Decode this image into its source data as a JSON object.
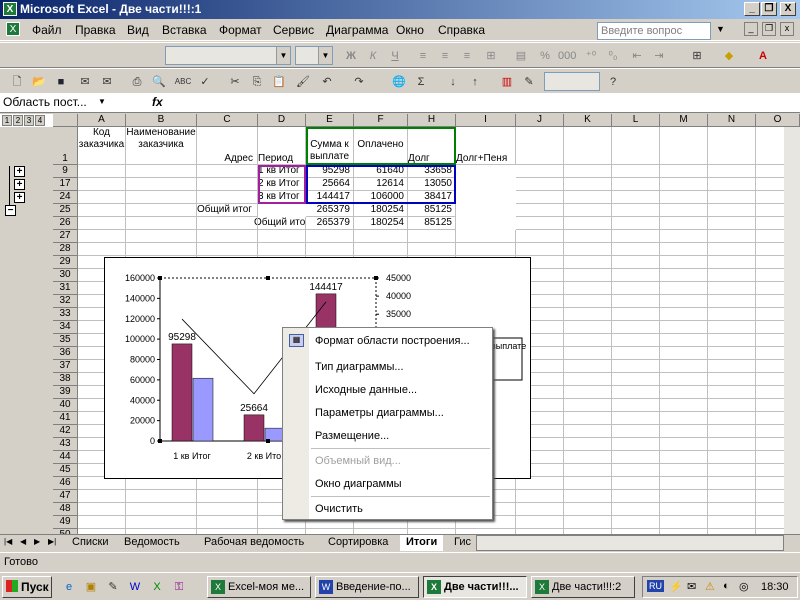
{
  "window": {
    "title": "Microsoft Excel - Две части!!!:1",
    "minimize": "_",
    "restore": "❐",
    "close": "X"
  },
  "menu": {
    "items": [
      "Файл",
      "Правка",
      "Вид",
      "Вставка",
      "Формат",
      "Сервис",
      "Диаграмма",
      "Окно",
      "Справка"
    ],
    "help_placeholder": "Введите вопрос"
  },
  "toolbar": {
    "zoom": ""
  },
  "formula": {
    "name_box": "Область пост...",
    "fx": "fx",
    "value": ""
  },
  "outline": {
    "levels": [
      "1",
      "2",
      "3",
      "4"
    ]
  },
  "columns": [
    "A",
    "B",
    "C",
    "D",
    "E",
    "F",
    "H",
    "I",
    "J",
    "K",
    "L",
    "M",
    "N",
    "O"
  ],
  "headers": {
    "row": "1",
    "A": "Код заказчика",
    "B": "Наименование заказчика",
    "C": "Адрес",
    "D": "Период",
    "E": "Сумма к выплате",
    "F": "Оплачено",
    "H": "Долг",
    "I": "Долг+Пеня"
  },
  "rows": [
    {
      "num": "9",
      "D": "1 кв Итог",
      "E": "95298",
      "F": "61640",
      "H": "33658"
    },
    {
      "num": "17",
      "D": "2 кв Итог",
      "E": "25664",
      "F": "12614",
      "H": "13050"
    },
    {
      "num": "24",
      "D": "3 кв Итог",
      "E": "144417",
      "F": "106000",
      "H": "38417"
    },
    {
      "num": "25",
      "C": "Общий итог",
      "E": "265379",
      "F": "180254",
      "H": "85125"
    },
    {
      "num": "26",
      "D": "Общий итог",
      "E": "265379",
      "F": "180254",
      "H": "85125"
    }
  ],
  "empty_rows": [
    "27",
    "28",
    "29",
    "30",
    "31",
    "32",
    "33",
    "34",
    "35",
    "36",
    "37",
    "38",
    "39",
    "40",
    "41",
    "42",
    "43",
    "44",
    "45",
    "46",
    "47",
    "48",
    "49",
    "50"
  ],
  "chart_data": {
    "type": "bar",
    "categories": [
      "1 кв Итог",
      "2 кв Итог",
      "3 кв Итог"
    ],
    "series": [
      {
        "values": [
          95298,
          25664,
          144417
        ],
        "color": "#993366"
      },
      {
        "values": [
          61640,
          12614,
          106000
        ],
        "color": "#9999ff"
      }
    ],
    "line_series": {
      "values": [
        33658,
        13050,
        38417
      ],
      "axis": "secondary"
    },
    "data_labels": [
      "95298",
      "25664",
      "144417"
    ],
    "ylim": [
      0,
      160000
    ],
    "y_ticks": [
      "160000",
      "140000",
      "120000",
      "100000",
      "80000",
      "60000",
      "40000",
      "20000",
      "0"
    ],
    "y2_ticks": [
      "45000",
      "40000",
      "35000",
      "30000"
    ],
    "y2_range": [
      0,
      45000
    ],
    "legend_text": "выплате",
    "x_tick_labels_visible": [
      "1 кв  Итог",
      "2 кв  Ито"
    ]
  },
  "context_menu": {
    "items": [
      {
        "label": "Формат области построения...",
        "disabled": false
      },
      {
        "label": "Тип диаграммы...",
        "disabled": false
      },
      {
        "label": "Исходные данные...",
        "disabled": false
      },
      {
        "label": "Параметры диаграммы...",
        "disabled": false
      },
      {
        "label": "Размещение...",
        "disabled": false
      },
      {
        "label": "Объемный вид...",
        "disabled": true
      },
      {
        "label": "Окно диаграммы",
        "disabled": false
      },
      {
        "label": "Очистить",
        "disabled": false
      }
    ]
  },
  "sheets": {
    "tabs": [
      "Списки",
      "Ведомость",
      "Рабочая ведомость",
      "Сортировка",
      "Итоги",
      "Гис"
    ],
    "active": "Итоги"
  },
  "status": {
    "text": "Готово"
  },
  "taskbar": {
    "start": "Пуск",
    "tasks": [
      "Excel-моя ме...",
      "Введение-по...",
      "Две части!!!...",
      "Две части!!!:2"
    ],
    "lang": "RU",
    "clock": "18:30"
  }
}
